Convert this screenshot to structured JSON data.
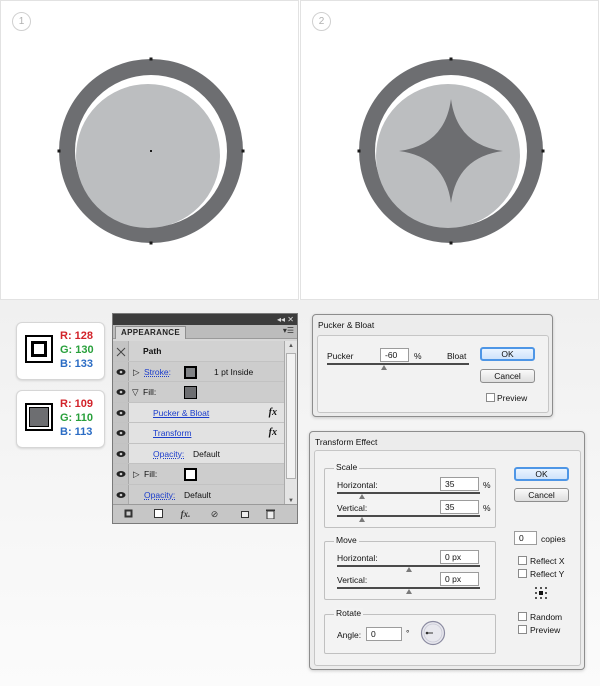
{
  "artboards": [
    {
      "step": "1"
    },
    {
      "step": "2"
    }
  ],
  "colors": {
    "outer_ring": "#6d6e71",
    "inner_fill": "#bcbec0",
    "highlight": "#ffffff",
    "star": "#6d6e71"
  },
  "swatches": [
    {
      "r": "R: 128",
      "g": "G: 130",
      "b": "B: 133",
      "color": "#808285"
    },
    {
      "r": "R: 109",
      "g": "G: 110",
      "b": "B: 113",
      "color": "#6d6e71"
    }
  ],
  "appearance": {
    "tab": "APPEARANCE",
    "title_controls": "◂◂  ✕",
    "menu_icon": "▾☰",
    "path_label": "Path",
    "stroke_label": "Stroke:",
    "stroke_value": "1 pt  Inside",
    "fill_label": "Fill:",
    "effects": [
      {
        "label": "Pucker & Bloat",
        "fx": "fx"
      },
      {
        "label": "Transform",
        "fx": "fx"
      }
    ],
    "opacity_label": "Opacity:",
    "opacity_value": "Default",
    "fill2_label": "Fill:",
    "opacity2_label": "Opacity:",
    "opacity2_value": "Default",
    "footer_fx": "fx."
  },
  "pucker": {
    "title": "Pucker & Bloat",
    "pucker_label": "Pucker",
    "value": "-60",
    "unit": "%",
    "bloat_label": "Bloat",
    "ok": "OK",
    "cancel": "Cancel",
    "preview": "Preview",
    "slider_position": 0.4
  },
  "transform": {
    "title": "Transform Effect",
    "scale_title": "Scale",
    "horizontal_label": "Horizontal:",
    "horizontal_value": "35",
    "horizontal_unit": "%",
    "vertical_label": "Vertical:",
    "vertical_value": "35",
    "vertical_unit": "%",
    "move_title": "Move",
    "move_h_label": "Horizontal:",
    "move_h_value": "0 px",
    "move_v_label": "Vertical:",
    "move_v_value": "0 px",
    "rotate_title": "Rotate",
    "angle_label": "Angle:",
    "angle_value": "0",
    "angle_unit": "°",
    "ok": "OK",
    "cancel": "Cancel",
    "copies_value": "0",
    "copies_label": "copies",
    "reflect_x": "Reflect X",
    "reflect_y": "Reflect Y",
    "random": "Random",
    "preview": "Preview"
  }
}
